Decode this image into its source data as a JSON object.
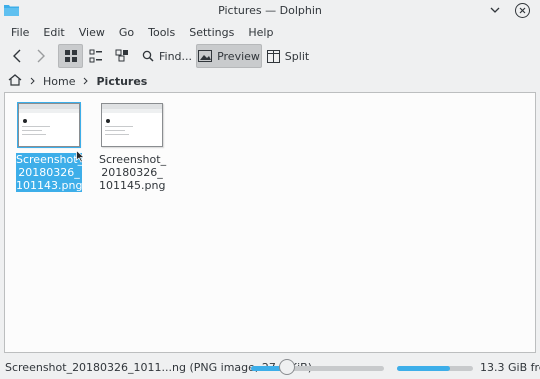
{
  "window": {
    "title": "Pictures — Dolphin"
  },
  "menu": [
    "File",
    "Edit",
    "View",
    "Go",
    "Tools",
    "Settings",
    "Help"
  ],
  "toolbar": {
    "find_label": "Find...",
    "preview_label": "Preview",
    "split_label": "Split"
  },
  "breadcrumb": {
    "home": "Home",
    "current": "Pictures"
  },
  "files": [
    {
      "name_lines": [
        "Screenshot_",
        "20180326_",
        "101143.png"
      ],
      "selected": true
    },
    {
      "name_lines": [
        "Screenshot_",
        "20180326_",
        "101145.png"
      ],
      "selected": false
    }
  ],
  "status": {
    "text": "Screenshot_20180326_1011...ng (PNG image, 27.3 KiB)",
    "zoom_fraction": 0.27,
    "space_used_fraction": 0.7,
    "free_space": "13.3 GiB free"
  },
  "colors": {
    "accent": "#3daee9",
    "background": "#eff0f1",
    "view": "#fcfcfc"
  }
}
